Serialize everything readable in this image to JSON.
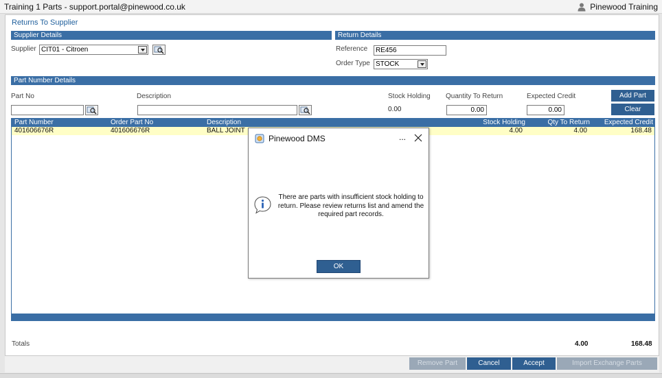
{
  "app": {
    "title": "Training 1 Parts - support.portal@pinewood.co.uk",
    "user": "Pinewood Training"
  },
  "page": {
    "title": "Returns To Supplier"
  },
  "supplier_details": {
    "header": "Supplier Details",
    "supplier_label": "Supplier",
    "supplier_value": "CIT01 - Citroen"
  },
  "return_details": {
    "header": "Return Details",
    "reference_label": "Reference",
    "reference_value": "RE456",
    "order_type_label": "Order Type",
    "order_type_value": "STOCK"
  },
  "part_details": {
    "header": "Part Number Details",
    "part_no_label": "Part No",
    "part_no_value": "",
    "description_label": "Description",
    "description_value": "",
    "stock_holding_label": "Stock Holding",
    "stock_holding_value": "0.00",
    "qty_to_return_label": "Quantity To Return",
    "qty_to_return_value": "0.00",
    "expected_credit_label": "Expected Credit",
    "expected_credit_value": "0.00",
    "add_part_label": "Add Part",
    "clear_label": "Clear"
  },
  "grid": {
    "columns": [
      "Part Number",
      "Order Part No",
      "Description",
      "Stock Holding",
      "Qty To Return",
      "Expected Credit"
    ],
    "rows": [
      {
        "part_number": "401606676R",
        "order_part_no": "401606676R",
        "description": "BALL JOINT",
        "stock_holding": "4.00",
        "qty_to_return": "4.00",
        "expected_credit": "168.48"
      }
    ]
  },
  "totals": {
    "label": "Totals",
    "qty_to_return": "4.00",
    "expected_credit": "168.48"
  },
  "actions": {
    "remove_part": "Remove Part",
    "cancel": "Cancel",
    "accept": "Accept",
    "import_exchange": "Import Exchange Parts"
  },
  "dialog": {
    "title": "Pinewood DMS",
    "more": "...",
    "message": "There are parts with insufficient stock holding to return. Please review returns list and amend the required part records.",
    "ok_label": "OK"
  },
  "colors": {
    "accent": "#3a6ea5",
    "button": "#2f5f91",
    "row_highlight": "#fffec6",
    "title_text": "#1f5f9c"
  },
  "icons": [
    "user-icon",
    "chevron-down-icon",
    "search-icon",
    "app-icon",
    "close-icon",
    "info-icon"
  ]
}
